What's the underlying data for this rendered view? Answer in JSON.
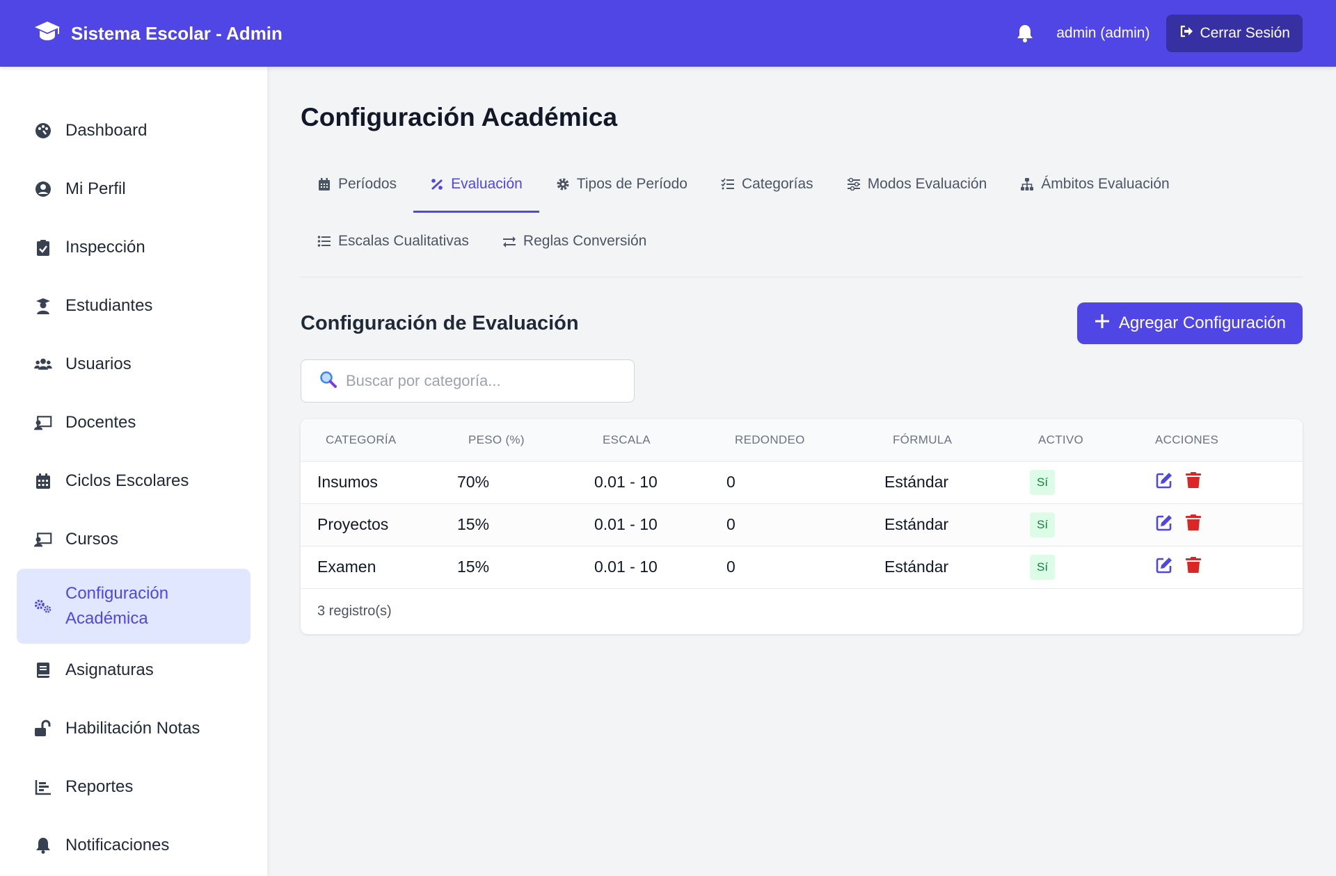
{
  "header": {
    "brand": "Sistema Escolar - Admin",
    "user": "admin (admin)",
    "logout_label": "Cerrar Sesión"
  },
  "sidebar": {
    "items": [
      {
        "label": "Dashboard",
        "icon": "palette-icon"
      },
      {
        "label": "Mi Perfil",
        "icon": "user-circle-icon"
      },
      {
        "label": "Inspección",
        "icon": "clipboard-check-icon"
      },
      {
        "label": "Estudiantes",
        "icon": "user-graduate-icon"
      },
      {
        "label": "Usuarios",
        "icon": "users-icon"
      },
      {
        "label": "Docentes",
        "icon": "chalkboard-teacher-icon"
      },
      {
        "label": "Ciclos Escolares",
        "icon": "calendar-icon"
      },
      {
        "label": "Cursos",
        "icon": "chalkboard-teacher-icon"
      },
      {
        "label": "Configuración Académica",
        "label_line1": "Configuración",
        "label_line2": "Académica",
        "icon": "cogs-icon",
        "active": true
      },
      {
        "label": "Asignaturas",
        "icon": "book-icon"
      },
      {
        "label": "Habilitación Notas",
        "icon": "unlock-icon"
      },
      {
        "label": "Reportes",
        "icon": "chart-bar-icon"
      },
      {
        "label": "Notificaciones",
        "icon": "bell-icon"
      }
    ]
  },
  "main": {
    "title": "Configuración Académica",
    "tabs": [
      {
        "label": "Períodos",
        "icon": "calendar-icon"
      },
      {
        "label": "Evaluación",
        "icon": "percent-icon",
        "active": true
      },
      {
        "label": "Tipos de Período",
        "icon": "gear-icon"
      },
      {
        "label": "Categorías",
        "icon": "list-check-icon"
      },
      {
        "label": "Modos Evaluación",
        "icon": "sliders-icon"
      },
      {
        "label": "Ámbitos Evaluación",
        "icon": "sitemap-icon"
      },
      {
        "label": "Escalas Cualitativas",
        "icon": "list-icon"
      },
      {
        "label": "Reglas Conversión",
        "icon": "exchange-icon"
      }
    ],
    "section_title": "Configuración de Evaluación",
    "add_label": "Agregar Configuración",
    "search_placeholder": "Buscar por categoría...",
    "table": {
      "columns": [
        "Categoría",
        "Peso (%)",
        "Escala",
        "Redondeo",
        "Fórmula",
        "Activo",
        "Acciones"
      ],
      "rows": [
        {
          "categoria": "Insumos",
          "peso": "70%",
          "escala": "0.01 - 10",
          "redondeo": "0",
          "formula": "Estándar",
          "activo": "Sí"
        },
        {
          "categoria": "Proyectos",
          "peso": "15%",
          "escala": "0.01 - 10",
          "redondeo": "0",
          "formula": "Estándar",
          "activo": "Sí"
        },
        {
          "categoria": "Examen",
          "peso": "15%",
          "escala": "0.01 - 10",
          "redondeo": "0",
          "formula": "Estándar",
          "activo": "Sí"
        }
      ],
      "footer": "3 registro(s)"
    }
  },
  "colors": {
    "primary": "#4f46e5",
    "primary_dark": "#3730a3",
    "active_bg": "#e0e7ff",
    "danger": "#dc2626",
    "success_bg": "#dcfce7",
    "success_text": "#15803d"
  }
}
